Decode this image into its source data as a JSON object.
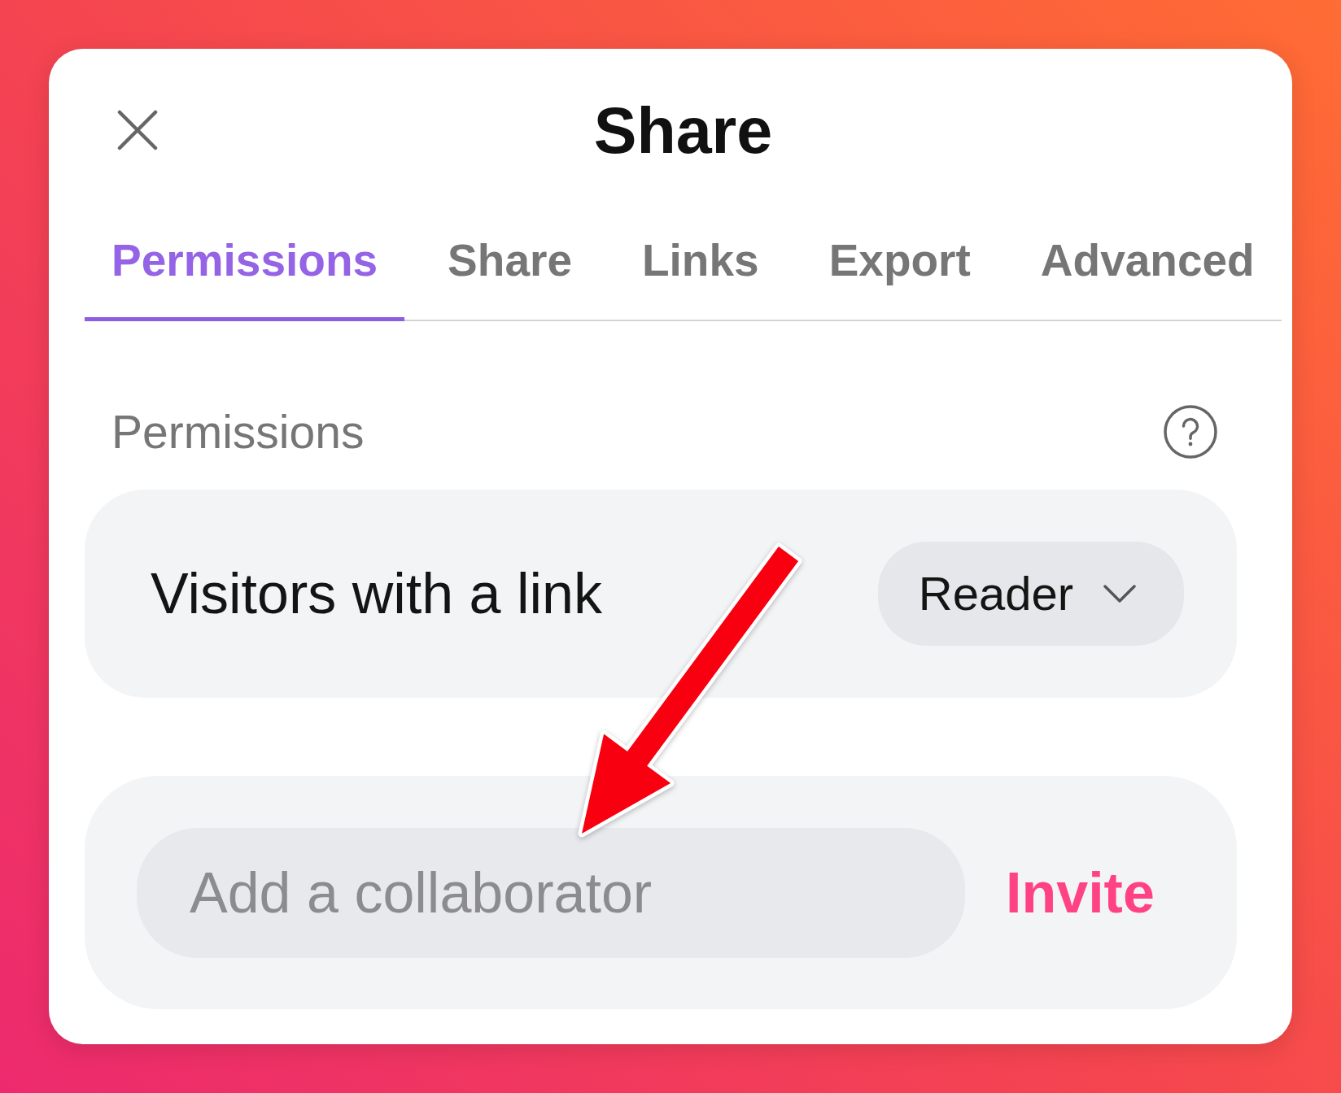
{
  "dialog": {
    "title": "Share"
  },
  "tabs": [
    {
      "label": "Permissions",
      "selected": true
    },
    {
      "label": "Share",
      "selected": false
    },
    {
      "label": "Links",
      "selected": false
    },
    {
      "label": "Export",
      "selected": false
    },
    {
      "label": "Advanced",
      "selected": false
    }
  ],
  "permissions": {
    "heading": "Permissions",
    "rows": [
      {
        "label": "Visitors with a link",
        "role": "Reader"
      }
    ]
  },
  "invite": {
    "placeholder": "Add a collaborator",
    "button": "Invite"
  }
}
